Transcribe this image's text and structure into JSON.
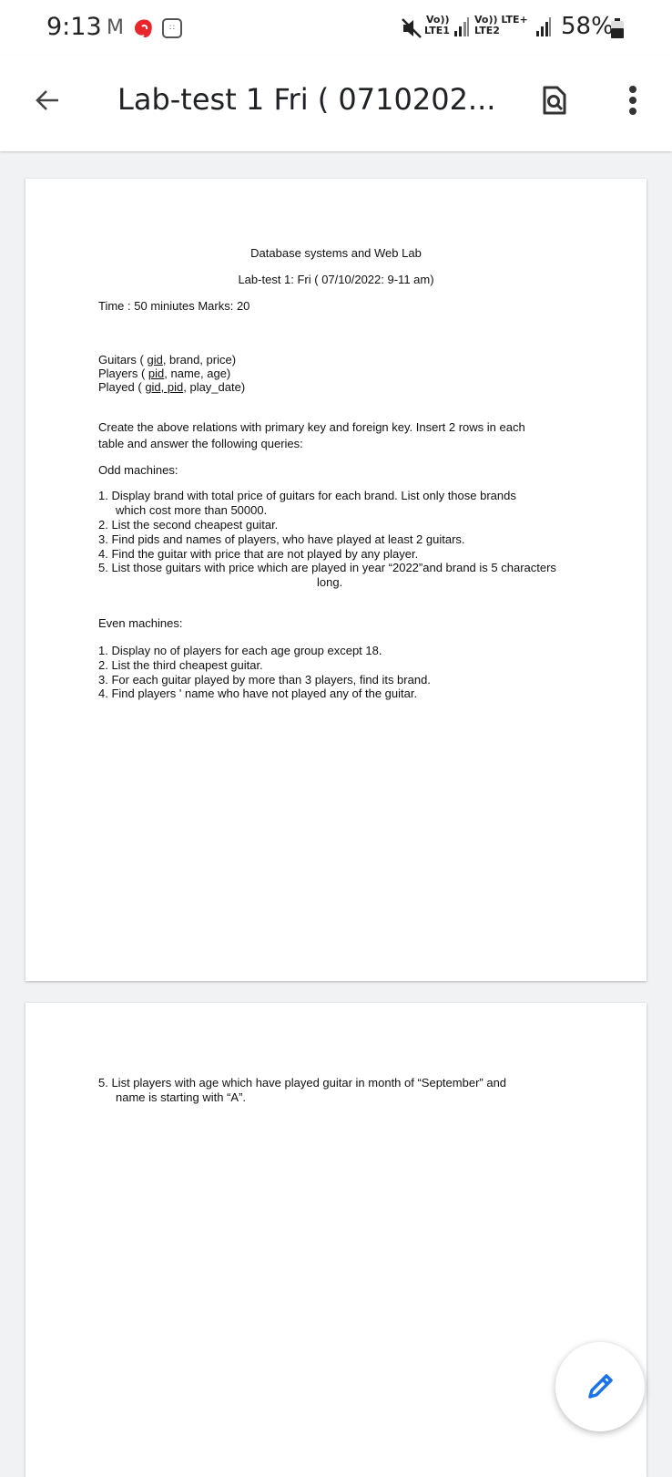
{
  "status_bar": {
    "time": "9:13",
    "gmail_icon": "gmail-icon",
    "net1_top": "Vo))",
    "net1_bottom": "LTE1",
    "net2_top": "Vo)) LTE+",
    "net2_bottom": "LTE2",
    "battery_text": "58%"
  },
  "app_bar": {
    "title": "Lab-test 1 Fri ( 0710202...",
    "back_icon": "arrow-left-icon",
    "search_icon": "search-in-document-icon",
    "more_icon": "more-vert-icon"
  },
  "page1": {
    "heading": "Database systems and Web Lab",
    "subheading": "Lab-test 1: Fri ( 07/10/2022: 9-11 am)",
    "time_marks": "Time : 50 miniutes Marks: 20",
    "relations": [
      {
        "name": "Guitars ( ",
        "keys": "gid",
        "rest": ", brand, price)"
      },
      {
        "name": "Players ( ",
        "keys": "pid",
        "rest": ", name, age)"
      },
      {
        "name": "Played ( ",
        "keys": "gid, pid",
        "rest": ", play_date)"
      }
    ],
    "instructions_line1": "Create the above relations with primary key and foreign key. Insert 2 rows in each",
    "instructions_line2": "table and  answer the following queries:",
    "odd_heading": "Odd machines:",
    "odd_items": [
      "1. Display brand with total price of guitars for each brand. List only those brands",
      "which cost  more than 50000.",
      "2. List the second cheapest guitar.",
      "3. Find pids and names of players, who have played at least 2 guitars.",
      "4. Find the guitar with price that are not played by any player.",
      "5. List those guitars with price which are played in year “2022”and brand is 5 characters",
      "long."
    ],
    "even_heading": "Even machines:",
    "even_items": [
      "1. Display no of players for each age group except 18.",
      "2. List the third cheapest guitar.",
      "3. For each guitar played by more than 3 players, find its brand.",
      "4. Find players ' name who have not played any of the guitar."
    ]
  },
  "page2": {
    "item5_line1": "5. List players with age which have played guitar in month of “September” and",
    "item5_line2": "name is  starting with “A”."
  },
  "fab": {
    "icon": "edit-pencil-icon"
  },
  "colors": {
    "fab_pencil": "#1a73e8",
    "page_bg": "#f1f2f4",
    "airtel_red": "#e8262b"
  }
}
